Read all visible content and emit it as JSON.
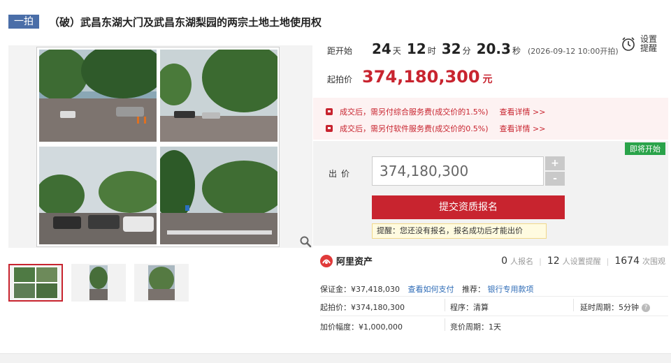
{
  "header": {
    "badge": "一拍",
    "title": "（破）武昌东湖大门及武昌东湖梨园的两宗土地土地使用权"
  },
  "countdown": {
    "label": "距开始",
    "days": "24",
    "days_unit": "天",
    "hours": "12",
    "hours_unit": "时",
    "minutes": "32",
    "minutes_unit": "分",
    "seconds": "20.3",
    "seconds_unit": "秒",
    "start_note": "(2026-09-12 10:00开拍)"
  },
  "remind": {
    "line1": "设置",
    "line2": "提醒",
    "icon": "alarm-clock-icon"
  },
  "price": {
    "label": "起拍价",
    "value": "374,180,300",
    "unit": "元"
  },
  "fees": [
    {
      "text": "成交后，需另付综合服务费(成交价的1.5%)",
      "link": "查看详情 >>"
    },
    {
      "text": "成交后，需另付软件服务费(成交价的0.5%)",
      "link": "查看详情 >>"
    }
  ],
  "bid": {
    "status_badge": "即将开始",
    "label": "出价",
    "value": "374,180,300",
    "plus": "+",
    "minus": "-",
    "submit_label": "提交资质报名",
    "tip": "提醒：您还没有报名，报名成功后才能出价"
  },
  "brand": {
    "name": "阿里资产"
  },
  "stats": {
    "signups": "0",
    "signups_label": "人报名",
    "reminders": "12",
    "reminders_label": "人设置提醒",
    "views": "1674",
    "views_label": "次围观"
  },
  "details": {
    "deposit_label": "保证金：¥37,418,030",
    "how_to_pay": "查看如何支付",
    "recommend_label": "推荐：",
    "recommend_link": "银行专用款项",
    "start_price": "起拍价：¥374,180,300",
    "procedure": "程序：清算",
    "delay": "延时周期：5分钟",
    "increment": "加价幅度：¥1,000,000",
    "cycle": "竞价周期：1天"
  },
  "colors": {
    "accent": "#c8242f",
    "badge_blue": "#4a6ea8",
    "link_blue": "#2d6bb6",
    "soon_green": "#2aa34a"
  }
}
